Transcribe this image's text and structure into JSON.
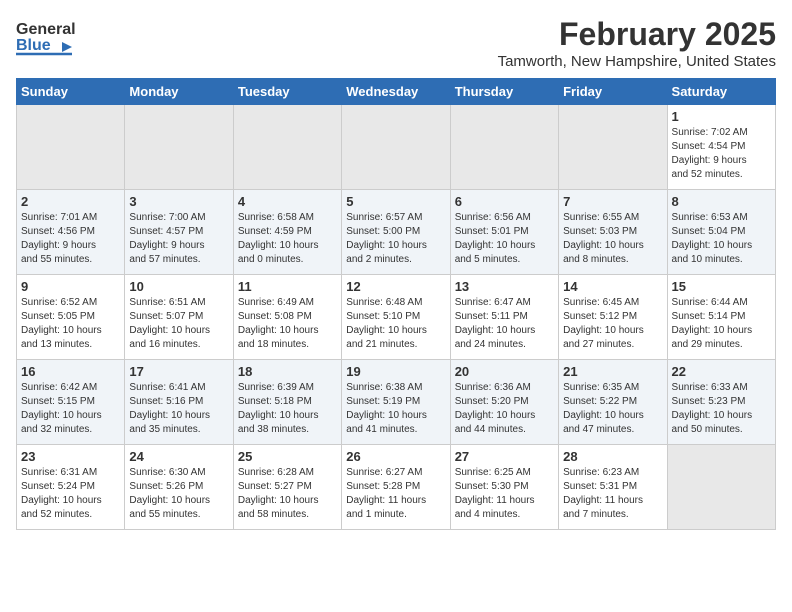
{
  "header": {
    "logo_general": "General",
    "logo_blue": "Blue",
    "title": "February 2025",
    "subtitle": "Tamworth, New Hampshire, United States"
  },
  "weekdays": [
    "Sunday",
    "Monday",
    "Tuesday",
    "Wednesday",
    "Thursday",
    "Friday",
    "Saturday"
  ],
  "weeks": [
    [
      {
        "day": "",
        "info": ""
      },
      {
        "day": "",
        "info": ""
      },
      {
        "day": "",
        "info": ""
      },
      {
        "day": "",
        "info": ""
      },
      {
        "day": "",
        "info": ""
      },
      {
        "day": "",
        "info": ""
      },
      {
        "day": "1",
        "info": "Sunrise: 7:02 AM\nSunset: 4:54 PM\nDaylight: 9 hours\nand 52 minutes."
      }
    ],
    [
      {
        "day": "2",
        "info": "Sunrise: 7:01 AM\nSunset: 4:56 PM\nDaylight: 9 hours\nand 55 minutes."
      },
      {
        "day": "3",
        "info": "Sunrise: 7:00 AM\nSunset: 4:57 PM\nDaylight: 9 hours\nand 57 minutes."
      },
      {
        "day": "4",
        "info": "Sunrise: 6:58 AM\nSunset: 4:59 PM\nDaylight: 10 hours\nand 0 minutes."
      },
      {
        "day": "5",
        "info": "Sunrise: 6:57 AM\nSunset: 5:00 PM\nDaylight: 10 hours\nand 2 minutes."
      },
      {
        "day": "6",
        "info": "Sunrise: 6:56 AM\nSunset: 5:01 PM\nDaylight: 10 hours\nand 5 minutes."
      },
      {
        "day": "7",
        "info": "Sunrise: 6:55 AM\nSunset: 5:03 PM\nDaylight: 10 hours\nand 8 minutes."
      },
      {
        "day": "8",
        "info": "Sunrise: 6:53 AM\nSunset: 5:04 PM\nDaylight: 10 hours\nand 10 minutes."
      }
    ],
    [
      {
        "day": "9",
        "info": "Sunrise: 6:52 AM\nSunset: 5:05 PM\nDaylight: 10 hours\nand 13 minutes."
      },
      {
        "day": "10",
        "info": "Sunrise: 6:51 AM\nSunset: 5:07 PM\nDaylight: 10 hours\nand 16 minutes."
      },
      {
        "day": "11",
        "info": "Sunrise: 6:49 AM\nSunset: 5:08 PM\nDaylight: 10 hours\nand 18 minutes."
      },
      {
        "day": "12",
        "info": "Sunrise: 6:48 AM\nSunset: 5:10 PM\nDaylight: 10 hours\nand 21 minutes."
      },
      {
        "day": "13",
        "info": "Sunrise: 6:47 AM\nSunset: 5:11 PM\nDaylight: 10 hours\nand 24 minutes."
      },
      {
        "day": "14",
        "info": "Sunrise: 6:45 AM\nSunset: 5:12 PM\nDaylight: 10 hours\nand 27 minutes."
      },
      {
        "day": "15",
        "info": "Sunrise: 6:44 AM\nSunset: 5:14 PM\nDaylight: 10 hours\nand 29 minutes."
      }
    ],
    [
      {
        "day": "16",
        "info": "Sunrise: 6:42 AM\nSunset: 5:15 PM\nDaylight: 10 hours\nand 32 minutes."
      },
      {
        "day": "17",
        "info": "Sunrise: 6:41 AM\nSunset: 5:16 PM\nDaylight: 10 hours\nand 35 minutes."
      },
      {
        "day": "18",
        "info": "Sunrise: 6:39 AM\nSunset: 5:18 PM\nDaylight: 10 hours\nand 38 minutes."
      },
      {
        "day": "19",
        "info": "Sunrise: 6:38 AM\nSunset: 5:19 PM\nDaylight: 10 hours\nand 41 minutes."
      },
      {
        "day": "20",
        "info": "Sunrise: 6:36 AM\nSunset: 5:20 PM\nDaylight: 10 hours\nand 44 minutes."
      },
      {
        "day": "21",
        "info": "Sunrise: 6:35 AM\nSunset: 5:22 PM\nDaylight: 10 hours\nand 47 minutes."
      },
      {
        "day": "22",
        "info": "Sunrise: 6:33 AM\nSunset: 5:23 PM\nDaylight: 10 hours\nand 50 minutes."
      }
    ],
    [
      {
        "day": "23",
        "info": "Sunrise: 6:31 AM\nSunset: 5:24 PM\nDaylight: 10 hours\nand 52 minutes."
      },
      {
        "day": "24",
        "info": "Sunrise: 6:30 AM\nSunset: 5:26 PM\nDaylight: 10 hours\nand 55 minutes."
      },
      {
        "day": "25",
        "info": "Sunrise: 6:28 AM\nSunset: 5:27 PM\nDaylight: 10 hours\nand 58 minutes."
      },
      {
        "day": "26",
        "info": "Sunrise: 6:27 AM\nSunset: 5:28 PM\nDaylight: 11 hours\nand 1 minute."
      },
      {
        "day": "27",
        "info": "Sunrise: 6:25 AM\nSunset: 5:30 PM\nDaylight: 11 hours\nand 4 minutes."
      },
      {
        "day": "28",
        "info": "Sunrise: 6:23 AM\nSunset: 5:31 PM\nDaylight: 11 hours\nand 7 minutes."
      },
      {
        "day": "",
        "info": ""
      }
    ]
  ]
}
